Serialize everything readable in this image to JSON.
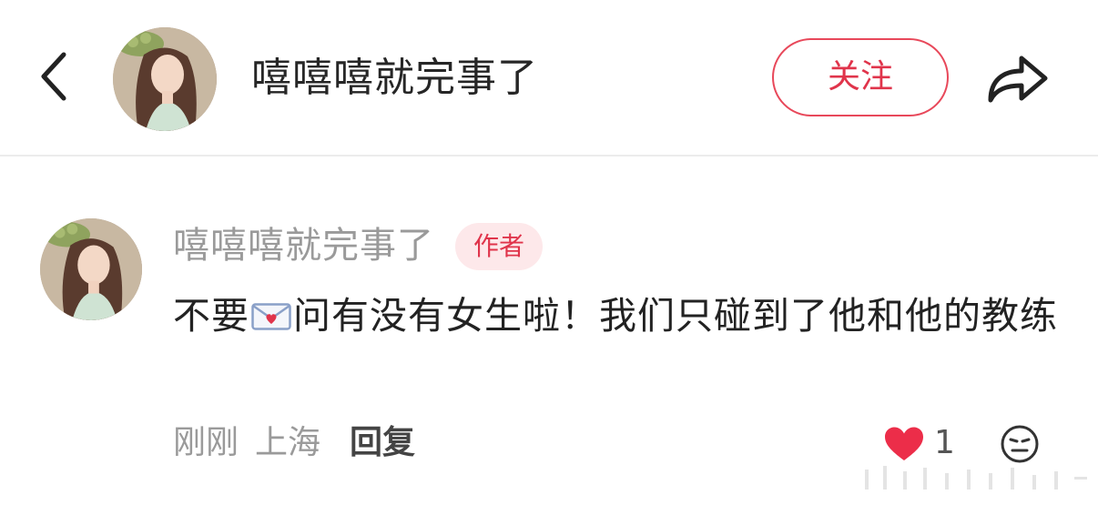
{
  "header": {
    "title": "嘻嘻嘻就完事了",
    "follow_label": "关注"
  },
  "comment": {
    "author": "嘻嘻嘻就完事了",
    "badge": "作者",
    "text_before_icon": "不要",
    "text_after_icon": "问有没有女生啦！我们只碰到了他和他的教练",
    "time": "刚刚",
    "location": "上海",
    "reply_label": "回复",
    "like_count": "1"
  },
  "colors": {
    "accent": "#e0344b",
    "badge_bg": "#fde8ea",
    "muted_text": "#9a9a9a"
  },
  "icons": {
    "back": "chevron-left-icon",
    "share": "share-arrow-icon",
    "envelope": "love-letter-icon",
    "like": "heart-icon",
    "dislike": "neutral-face-icon"
  }
}
